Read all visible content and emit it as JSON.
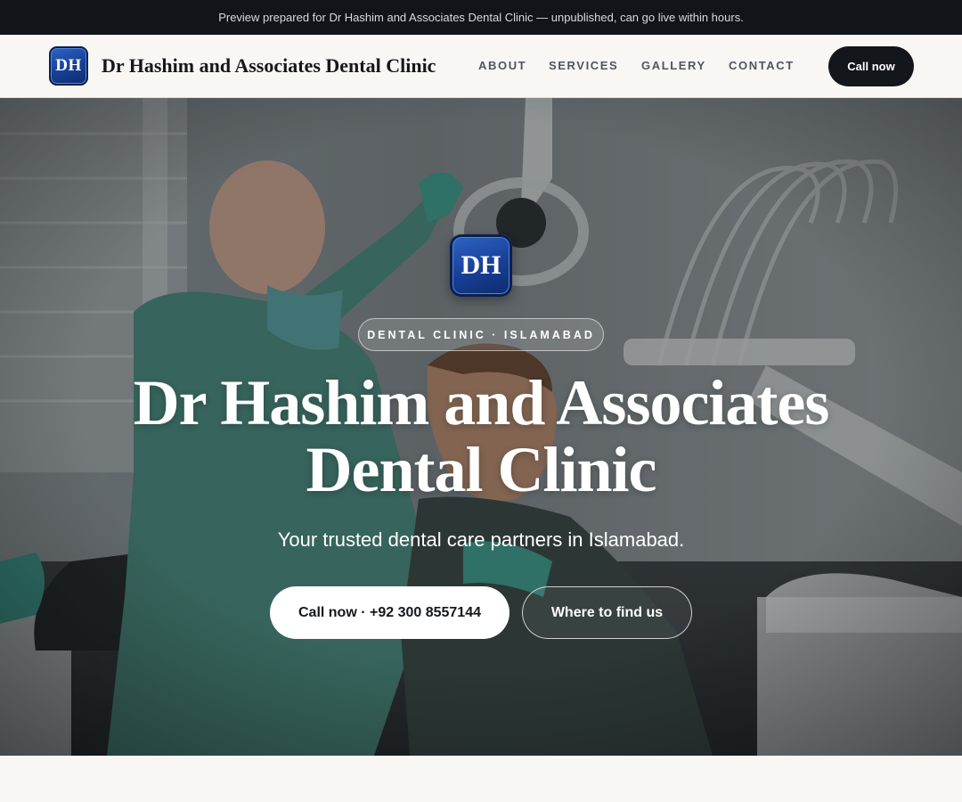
{
  "banner": {
    "text": "Preview prepared for Dr Hashim and Associates Dental Clinic — unpublished, can go live within hours."
  },
  "header": {
    "logo_initials": "DH",
    "brand_name": "Dr Hashim and Associates Dental Clinic",
    "nav": [
      "ABOUT",
      "SERVICES",
      "GALLERY",
      "CONTACT"
    ],
    "call_label": "Call now"
  },
  "hero": {
    "logo_initials": "DH",
    "eyebrow": "DENTAL CLINIC · ISLAMABAD",
    "title_line1": "Dr Hashim and Associates",
    "title_line2": "Dental Clinic",
    "subtitle": "Your trusted dental care partners in Islamabad.",
    "primary_button": "Call now · +92 300 8557144",
    "secondary_button": "Where to find us"
  },
  "colors": {
    "topbar": "#111418",
    "header_bg": "#f8f7f4",
    "accent_dark": "#13161b",
    "logo_blue": "#173f94"
  },
  "icons": {
    "hero_photo": "dentist-treating-patient-photo"
  }
}
